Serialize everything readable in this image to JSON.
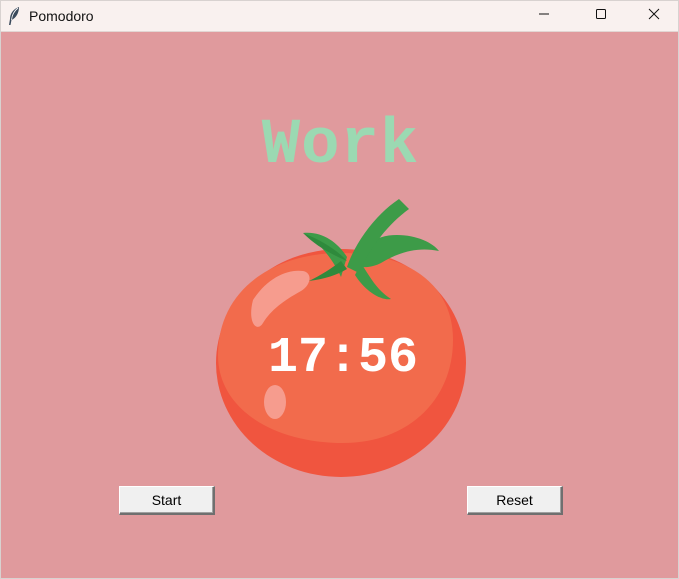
{
  "window": {
    "title": "Pomodoro",
    "background": "#e09a9d"
  },
  "icons": {
    "app": "feather-icon",
    "minimize": "minimize-icon",
    "maximize": "maximize-icon",
    "close": "close-icon"
  },
  "main": {
    "mode_label": "Work",
    "mode_color": "#9bd9b2",
    "timer": "17:56"
  },
  "buttons": {
    "start_label": "Start",
    "reset_label": "Reset"
  }
}
